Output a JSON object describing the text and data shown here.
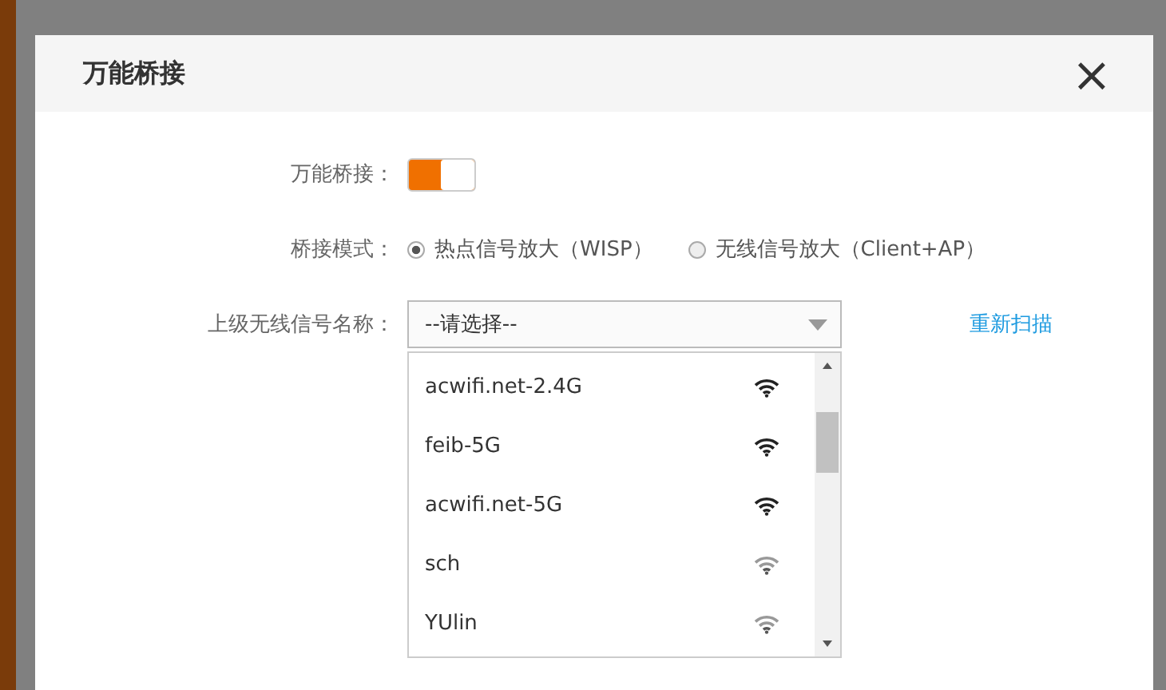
{
  "dialog": {
    "title": "万能桥接",
    "close": "×"
  },
  "bridge": {
    "label": "万能桥接：",
    "on": true
  },
  "mode": {
    "label": "桥接模式：",
    "options": [
      {
        "label": "热点信号放大（WISP）",
        "selected": true
      },
      {
        "label": "无线信号放大（Client+AP）",
        "selected": false
      }
    ]
  },
  "upstream": {
    "label": "上级无线信号名称：",
    "value": "--请选择--",
    "expanded": true,
    "rescan": "重新扫描",
    "networks": [
      {
        "name": "acwifi.net-2.4G",
        "kind": "strong"
      },
      {
        "name": "feib-5G",
        "kind": "strong"
      },
      {
        "name": "acwifi.net-5G",
        "kind": "strong"
      },
      {
        "name": "sch",
        "kind": "weak"
      },
      {
        "name": "YUlin",
        "kind": "weak"
      }
    ]
  }
}
